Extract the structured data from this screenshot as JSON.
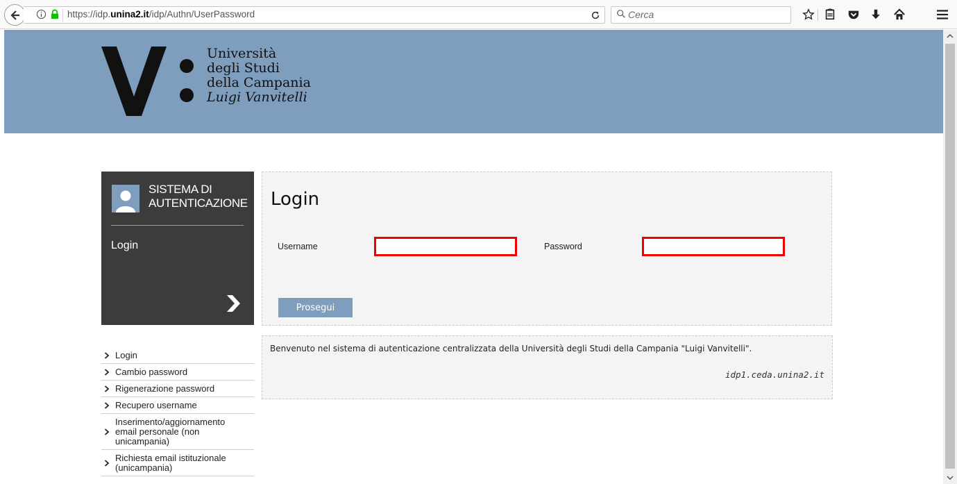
{
  "browser": {
    "url_prefix": "https://idp.",
    "url_domain": "unina2.it",
    "url_path": "/idp/Authn/UserPassword",
    "search_placeholder": "Cerca",
    "icons": [
      "back-arrow-icon",
      "info-icon",
      "lock-icon",
      "reload-icon",
      "search-icon",
      "bookmark-star-icon",
      "reading-list-icon",
      "pocket-icon",
      "download-icon",
      "home-icon",
      "menu-icon"
    ]
  },
  "header": {
    "logo_lines": [
      "Università",
      "degli Studi",
      "della Campania"
    ],
    "logo_italic_line": "Luigi Vanvitelli"
  },
  "side_box": {
    "title_line1": "SISTEMA DI",
    "title_line2": "AUTENTICAZIONE",
    "current_label": "Login"
  },
  "side_nav": {
    "items": [
      {
        "label": "Login"
      },
      {
        "label": "Cambio password"
      },
      {
        "label": "Rigenerazione password"
      },
      {
        "label": "Recupero username"
      },
      {
        "label": "Inserimento/aggiornamento email personale (non unicampania)"
      },
      {
        "label": "Richiesta email istituzionale (unicampania)"
      }
    ]
  },
  "login_form": {
    "title": "Login",
    "username_label": "Username",
    "password_label": "Password",
    "username_value": "",
    "password_value": "",
    "submit_label": "Prosegui"
  },
  "info": {
    "welcome_text": "Benvenuto nel sistema di autenticazione centralizzata della Università degli Studi della Campania \"Luigi Vanvitelli\".",
    "host": "idp1.ceda.unina2.it"
  },
  "colors": {
    "accent": "#7f9dbd",
    "side_box_bg": "#3c3c3c",
    "panel_bg": "#f4f4f4",
    "input_border": "#ee0000"
  }
}
